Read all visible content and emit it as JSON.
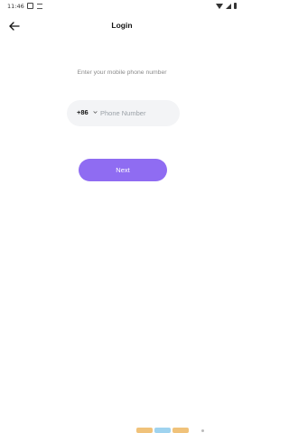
{
  "status_bar": {
    "time": "11:46"
  },
  "header": {
    "title": "Login",
    "back_icon": "arrow-left-icon"
  },
  "prompt": "Enter your mobile phone number",
  "phone": {
    "country_code": "+86",
    "value": "",
    "placeholder": "Phone Number"
  },
  "next_button_label": "Next",
  "colors": {
    "accent": "#8f6cf2",
    "input_background": "#f3f4f6",
    "placeholder": "#9aa0a6"
  },
  "bottom_strip_colors": [
    "#f0c27a",
    "#9fd3ef",
    "#f0c27a"
  ]
}
